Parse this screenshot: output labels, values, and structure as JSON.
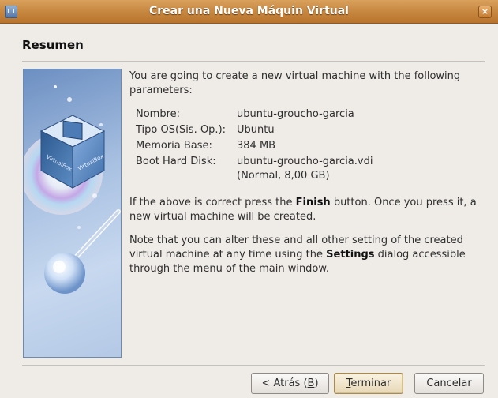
{
  "window": {
    "title": "Crear una Nueva Máquin Virtual",
    "close_glyph": "×"
  },
  "section": {
    "title": "Resumen"
  },
  "content": {
    "intro": "You are going to create a new virtual machine with the following parameters:",
    "params": [
      {
        "label": "Nombre:",
        "value": "ubuntu-groucho-garcia"
      },
      {
        "label": "Tipo OS(Sis. Op.):",
        "value": "Ubuntu"
      },
      {
        "label": "Memoria Base:",
        "value": "384 MB"
      },
      {
        "label": "Boot Hard Disk:",
        "value": "ubuntu-groucho-garcia.vdi (Normal, 8,00 GB)"
      }
    ],
    "finish_pre": "If the above is correct press the ",
    "finish_bold": "Finish",
    "finish_post": " button. Once you press it, a new virtual machine will be created.",
    "note_pre": "Note that you can alter these and all other setting of the created virtual machine at any time using the ",
    "note_bold": "Settings",
    "note_post": " dialog accessible through the menu of the main window."
  },
  "buttons": {
    "back_pre": "< Atrás (",
    "back_mnemonic": "B",
    "back_post": ")",
    "finish_mnemonic": "T",
    "finish_rest": "erminar",
    "cancel": "Cancelar"
  },
  "icons": {
    "window_icon": "virtualbox-window-icon",
    "art": "virtualbox-box-cd-icon"
  },
  "colors": {
    "titlebar": "#c98a43",
    "window_bg": "#efebe7",
    "art_bg": "#a9c1e2"
  }
}
